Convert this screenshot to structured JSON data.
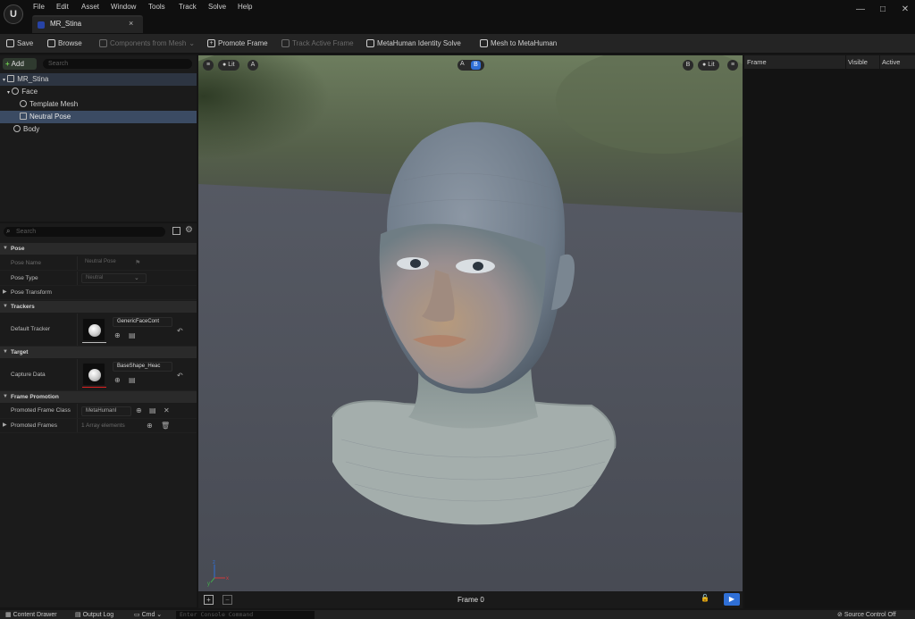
{
  "app": {
    "logo": "U"
  },
  "menu": [
    "File",
    "Edit",
    "Asset",
    "Window",
    "Tools",
    "Track",
    "Solve",
    "Help"
  ],
  "tab": {
    "title": "MR_Stina",
    "close": "×"
  },
  "window_controls": {
    "minimize": "—",
    "maximize": "□",
    "close": "✕"
  },
  "toolbar": {
    "save": "Save",
    "browse": "Browse",
    "components_from_mesh": "Components from Mesh",
    "promote_frame": "Promote Frame",
    "track_active_frame": "Track Active Frame",
    "metahuman_identity_solve": "MetaHuman Identity Solve",
    "mesh_to_metahuman": "Mesh to MetaHuman"
  },
  "outliner": {
    "add_label": "Add",
    "search_placeholder": "Search",
    "items": [
      {
        "label": "MR_Stina"
      },
      {
        "label": "Face"
      },
      {
        "label": "Template Mesh"
      },
      {
        "label": "Neutral Pose"
      },
      {
        "label": "Body"
      }
    ]
  },
  "details": {
    "search_placeholder": "Search",
    "sections": {
      "pose": "Pose",
      "trackers": "Trackers",
      "target": "Target",
      "frame_promotion": "Frame Promotion"
    },
    "pose_name_label": "Pose Name",
    "pose_name_value": "Neutral Pose",
    "pose_type_label": "Pose Type",
    "pose_type_value": "Neutral",
    "pose_transform_label": "Pose Transform",
    "default_tracker_label": "Default Tracker",
    "default_tracker_value": "GenericFaceCont",
    "capture_data_label": "Capture Data",
    "capture_data_value": "BaseShape_Heac",
    "promoted_frame_class_label": "Promoted Frame Class",
    "promoted_frame_class_value": "MetaHumanI",
    "promoted_frames_label": "Promoted Frames",
    "promoted_frames_value": "1 Array elements"
  },
  "viewport": {
    "lit_left": "Lit",
    "view_a": "A",
    "ab_a": "A",
    "ab_b": "B",
    "view_b": "B",
    "lit_right": "Lit",
    "frame_label": "Frame 0"
  },
  "right_panel": {
    "columns": [
      "Frame",
      "Visible",
      "Active"
    ]
  },
  "bottom_bar": {
    "content_drawer": "Content Drawer",
    "output_log": "Output Log",
    "cmd": "Cmd",
    "console_placeholder": "Enter Console Command",
    "source_control": "Source Control Off"
  },
  "colors": {
    "accent": "#2f6fd6",
    "selection": "#3b4b63",
    "viewport_bg": "#505560"
  }
}
